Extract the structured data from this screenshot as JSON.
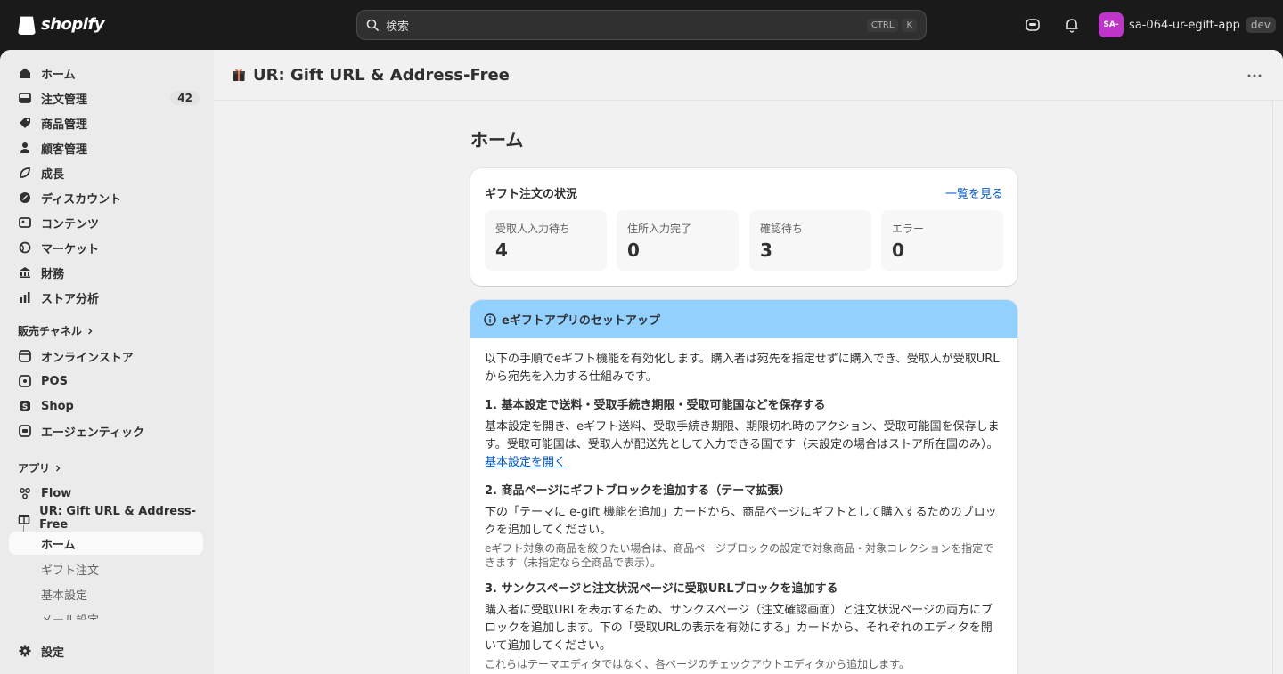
{
  "topbar": {
    "logo_text": "shopify",
    "search_placeholder": "検索",
    "shortcut_ctrl": "CTRL",
    "shortcut_key": "K",
    "store_avatar": "SA-",
    "store_name": "sa-064-ur-egift-app",
    "store_badge": "dev"
  },
  "sidebar": {
    "items": [
      {
        "label": "ホーム",
        "icon": "home-icon"
      },
      {
        "label": "注文管理",
        "icon": "orders-icon",
        "badge": "42"
      },
      {
        "label": "商品管理",
        "icon": "tag-icon"
      },
      {
        "label": "顧客管理",
        "icon": "person-icon"
      },
      {
        "label": "成長",
        "icon": "growth-icon"
      },
      {
        "label": "ディスカウント",
        "icon": "discount-icon"
      },
      {
        "label": "コンテンツ",
        "icon": "content-icon"
      },
      {
        "label": "マーケット",
        "icon": "globe-icon"
      },
      {
        "label": "財務",
        "icon": "bank-icon"
      },
      {
        "label": "ストア分析",
        "icon": "analytics-icon"
      }
    ],
    "channels_heading": "販売チャネル",
    "channels": [
      {
        "label": "オンラインストア",
        "icon": "store-icon"
      },
      {
        "label": "POS",
        "icon": "pos-icon"
      },
      {
        "label": "Shop",
        "icon": "shop-icon"
      },
      {
        "label": "エージェンティック",
        "icon": "agentic-icon"
      }
    ],
    "apps_heading": "アプリ",
    "apps": [
      {
        "label": "Flow",
        "icon": "flow-icon"
      },
      {
        "label": "UR: Gift URL & Address-Free",
        "icon": "gift-app-icon"
      }
    ],
    "app_subitems": [
      "ホーム",
      "ギフト注文",
      "基本設定",
      "メール設定"
    ],
    "settings_label": "設定"
  },
  "appbar": {
    "title": "UR: Gift URL & Address-Free"
  },
  "page": {
    "title": "ホーム",
    "status_card": {
      "title": "ギフト注文の状況",
      "link": "一覧を見る",
      "stats": [
        {
          "label": "受取人入力待ち",
          "value": "4"
        },
        {
          "label": "住所入力完了",
          "value": "0"
        },
        {
          "label": "確認待ち",
          "value": "3"
        },
        {
          "label": "エラー",
          "value": "0"
        }
      ]
    },
    "setup_card": {
      "title": "eギフトアプリのセットアップ",
      "intro": "以下の手順でeギフト機能を有効化します。購入者は宛先を指定せずに購入でき、受取人が受取URLから宛先を入力する仕組みです。",
      "step1_title": "1. 基本設定で送料・受取手続き期限・受取可能国などを保存する",
      "step1_body": "基本設定を開き、eギフト送料、受取手続き期限、期限切れ時のアクション、受取可能国を保存します。受取可能国は、受取人が配送先として入力できる国です（未設定の場合はストア所在国のみ）。",
      "step1_link": "基本設定を開く",
      "step2_title": "2. 商品ページにギフトブロックを追加する（テーマ拡張）",
      "step2_body": "下の「テーマに e-gift 機能を追加」カードから、商品ページにギフトとして購入するためのブロックを追加してください。",
      "step2_note": "eギフト対象の商品を絞りたい場合は、商品ページブロックの設定で対象商品・対象コレクションを指定できます（未指定なら全商品で表示）。",
      "step3_title": "3. サンクスページと注文状況ページに受取URLブロックを追加する",
      "step3_body": "購入者に受取URLを表示するため、サンクスページ（注文確認画面）と注文状況ページの両方にブロックを追加します。下の「受取URLの表示を有効にする」カードから、それぞれのエディタを開いて追加してください。",
      "step3_note": "これらはテーマエディタではなく、各ページのチェックアウトエディタから追加します。"
    }
  },
  "colors": {
    "topbar_bg": "#1a1a1a",
    "banner_bg": "#91d0ff",
    "link": "#005bd3",
    "avatar": "#c035c9"
  }
}
